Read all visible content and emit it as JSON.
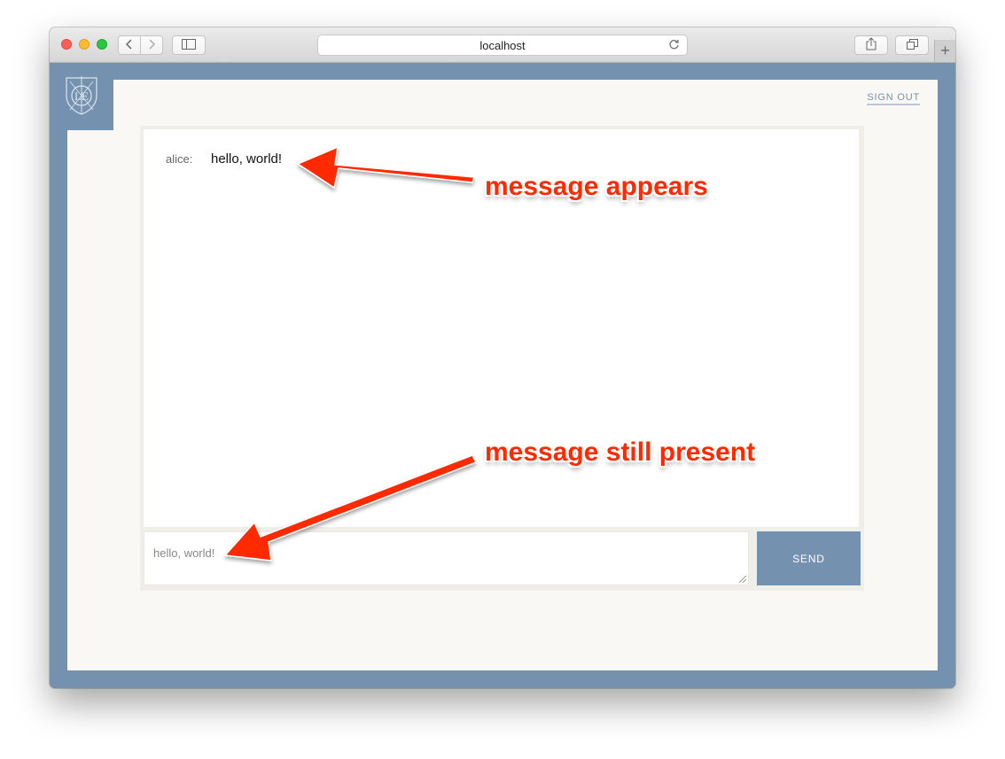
{
  "browser": {
    "url": "localhost",
    "back_icon": "chevron-left-icon",
    "forward_icon": "chevron-right-icon",
    "sidebar_icon": "sidebar-icon",
    "reload_icon": "reload-icon",
    "share_icon": "share-icon",
    "tabs_icon": "tabs-icon",
    "new_tab_label": "+"
  },
  "app": {
    "logo_icon": "shield-crest-logo",
    "sign_out_label": "SIGN OUT",
    "messages": [
      {
        "user": "alice:",
        "text": "hello, world!"
      }
    ],
    "input": {
      "value": "hello, world!"
    },
    "send_label": "SEND",
    "accent_color": "#7492b0"
  },
  "annotations": {
    "top": "message appears",
    "bottom": "message still present",
    "color": "#ff2a00"
  }
}
